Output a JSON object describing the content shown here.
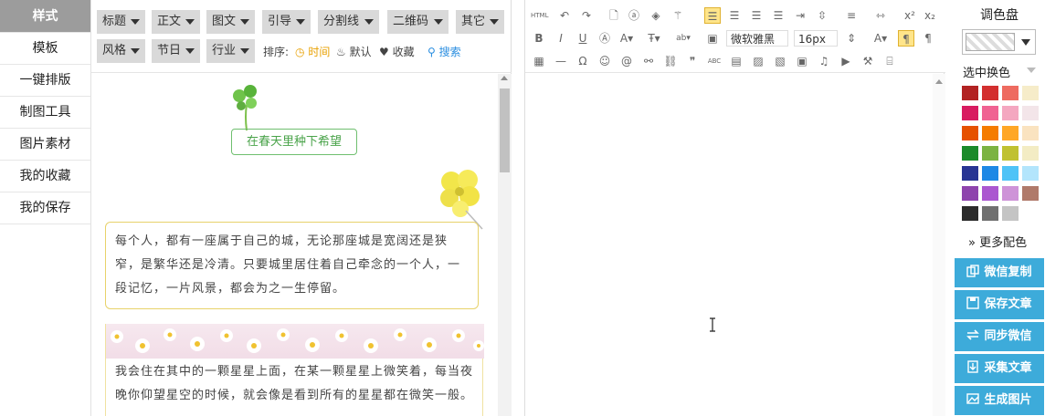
{
  "sidebar": {
    "items": [
      {
        "label": "样式",
        "active": true
      },
      {
        "label": "模板"
      },
      {
        "label": "一键排版"
      },
      {
        "label": "制图工具"
      },
      {
        "label": "图片素材"
      },
      {
        "label": "我的收藏"
      },
      {
        "label": "我的保存"
      }
    ]
  },
  "categories": [
    "标题",
    "正文",
    "图文",
    "引导",
    "分割线",
    "二维码",
    "其它",
    "风格",
    "节日",
    "行业"
  ],
  "sort": {
    "label": "排序:",
    "options": [
      "时间",
      "默认",
      "收藏"
    ],
    "search": "搜索"
  },
  "styles": {
    "spring_title": "在春天里种下希望",
    "card1_text": "每个人，都有一座属于自己的城，无论那座城是宽阔还是狭窄，是繁华还是冷清。只要城里居住着自己牵念的一个人，一段记忆，一片风景，都会为之一生停留。",
    "card2_text": "我会住在其中的一颗星星上面，在某一颗星星上微笑着，每当夜晚你仰望星空的时候，就会像是看到所有的星星都在微笑一般。"
  },
  "editor": {
    "font_family": "微软雅黑",
    "font_size": "16px"
  },
  "palette": {
    "title": "调色盘",
    "change_label": "选中换色",
    "more_label": "更多配色",
    "colors": [
      "#b22222",
      "#d32f2f",
      "#ee6b60",
      "#f6ecc9",
      "#d81b60",
      "#f06292",
      "#f4a7c0",
      "#f3e5e9",
      "#e65100",
      "#f57c00",
      "#ffa726",
      "#fae3c0",
      "#1b8a2a",
      "#7cb342",
      "#c0c131",
      "#f3ecc4",
      "#283593",
      "#1e88e5",
      "#4fc3f7",
      "#b3e5fc",
      "#8e44ad",
      "#ab57d0",
      "#ce93d8",
      "#b07a6a",
      "#2b2b2b",
      "#707070",
      "#c4c4c4"
    ]
  },
  "actions": [
    {
      "label": "微信复制",
      "icon": "copy-icon"
    },
    {
      "label": "保存文章",
      "icon": "save-icon"
    },
    {
      "label": "同步微信",
      "icon": "sync-icon"
    },
    {
      "label": "采集文章",
      "icon": "collect-icon"
    },
    {
      "label": "生成图片",
      "icon": "image-icon"
    }
  ]
}
